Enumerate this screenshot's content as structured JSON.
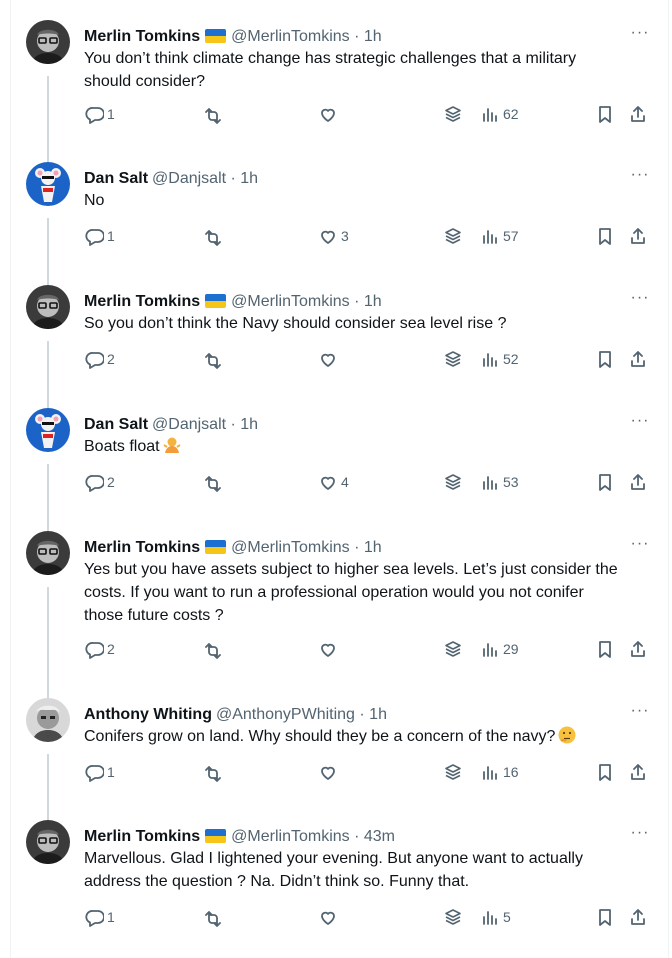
{
  "tweets": [
    {
      "name": "Merlin Tomkins",
      "flag": true,
      "handle": "@MerlinTomkins",
      "dot": "·",
      "time": "1h",
      "lines": [
        "You don’t think climate change has strategic challenges that a military",
        "should consider?"
      ],
      "replies": "1",
      "reposts": "",
      "likes": "",
      "views": "62",
      "avatar": "merlin"
    },
    {
      "name": "Dan Salt",
      "flag": false,
      "handle": "@Danjsalt",
      "dot": "·",
      "time": "1h",
      "lines": [
        "No"
      ],
      "replies": "1",
      "reposts": "",
      "likes": "3",
      "views": "57",
      "avatar": "dan"
    },
    {
      "name": "Merlin Tomkins",
      "flag": true,
      "handle": "@MerlinTomkins",
      "dot": "·",
      "time": "1h",
      "lines": [
        "So you don’t think the Navy should consider sea level rise ?"
      ],
      "replies": "2",
      "reposts": "",
      "likes": "",
      "views": "52",
      "avatar": "merlin"
    },
    {
      "name": "Dan Salt",
      "flag": false,
      "handle": "@Danjsalt",
      "dot": "·",
      "time": "1h",
      "lines": [
        "Boats float"
      ],
      "emoji": "person-shrugging-emoji",
      "replies": "2",
      "reposts": "",
      "likes": "4",
      "views": "53",
      "avatar": "dan"
    },
    {
      "name": "Merlin Tomkins",
      "flag": true,
      "handle": "@MerlinTomkins",
      "dot": "·",
      "time": "1h",
      "lines": [
        "Yes but you have assets subject to higher sea levels. Let’s just consider the",
        "costs. If you want to run a professional operation would you not conifer",
        "those future costs ?"
      ],
      "replies": "2",
      "reposts": "",
      "likes": "",
      "views": "29",
      "avatar": "merlin"
    },
    {
      "name": "Anthony Whiting",
      "flag": false,
      "handle": "@AnthonyPWhiting",
      "dot": "·",
      "time": "1h",
      "lines": [
        "Conifers grow on land. Why should they be a concern of the navy?"
      ],
      "emoji": "thinking-face-emoji",
      "replies": "1",
      "reposts": "",
      "likes": "",
      "views": "16",
      "avatar": "anthony"
    },
    {
      "name": "Merlin Tomkins",
      "flag": true,
      "handle": "@MerlinTomkins",
      "dot": "·",
      "time": "43m",
      "lines": [
        "Marvellous. Glad I lightened your evening. But anyone want to actually",
        "address the question ? Na. Didn’t think so. Funny that."
      ],
      "replies": "1",
      "reposts": "",
      "likes": "",
      "views": "5",
      "avatar": "merlin"
    }
  ],
  "more_label": "···",
  "colors": {
    "text": "#0f1419",
    "secondary": "#536471",
    "thread": "#cfd9de",
    "border": "#eff3f4"
  }
}
